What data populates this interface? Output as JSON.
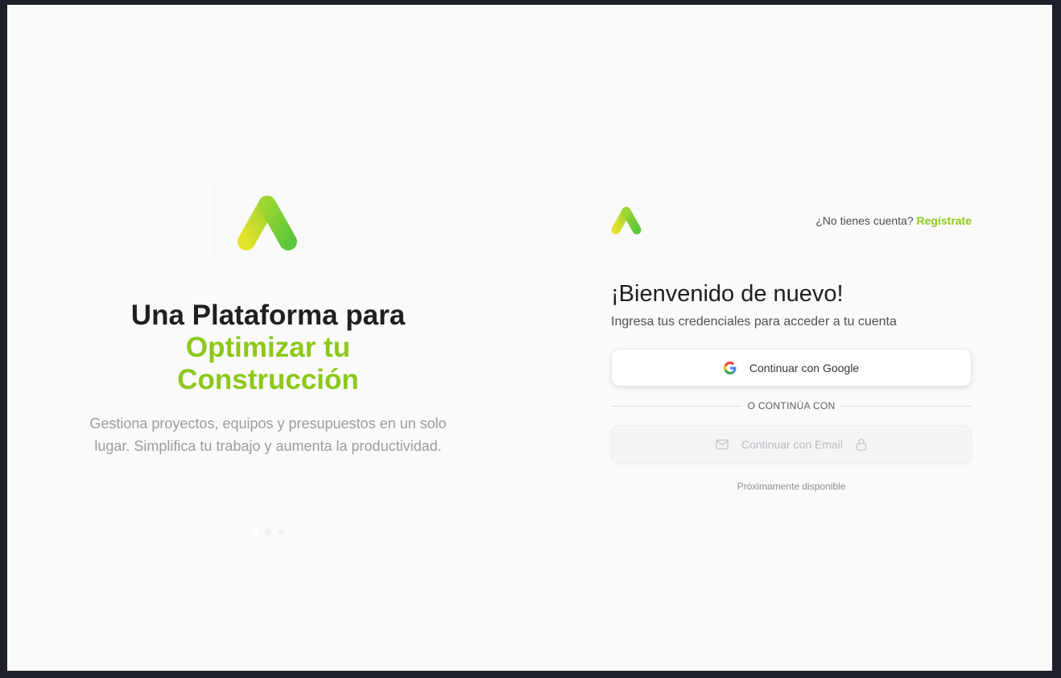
{
  "hero": {
    "title_line1": "Una Plataforma para",
    "title_line2": "Optimizar tu",
    "title_line3": "Construcción",
    "subtitle": "Gestiona proyectos, equipos y presupuestos en un solo lugar. Simplifica tu trabajo y aumenta la productividad.",
    "carousel": {
      "count": 3,
      "active_index": 0
    }
  },
  "auth": {
    "signup_prompt": "¿No tienes cuenta?",
    "signup_link": "Regístrate",
    "welcome_title": "¡Bienvenido de nuevo!",
    "welcome_subtitle": "Ingresa tus credenciales para acceder a tu cuenta",
    "google_button": "Continuar con Google",
    "divider_text": "O CONTINÚA CON",
    "email_button": "Continuar con Email",
    "coming_soon": "Próximamente disponible"
  },
  "icons": {
    "brand_logo": "brand-logo",
    "google": "google-icon",
    "mail": "mail-icon",
    "lock": "lock-icon"
  },
  "colors": {
    "accent": "#8cc81a",
    "logo_gradient_start": "#e3e32b",
    "logo_gradient_end": "#5cc83b",
    "background": "#fafafa"
  }
}
